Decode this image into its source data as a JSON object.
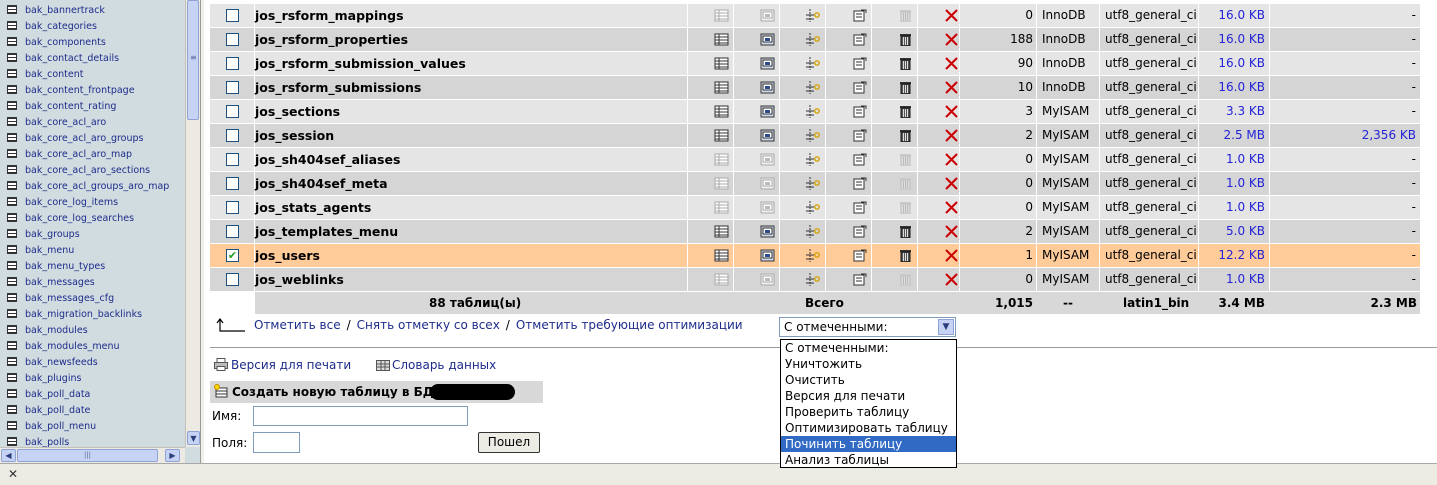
{
  "sidebar": {
    "items": [
      "bak_bannertrack",
      "bak_categories",
      "bak_components",
      "bak_contact_details",
      "bak_content",
      "bak_content_frontpage",
      "bak_content_rating",
      "bak_core_acl_aro",
      "bak_core_acl_aro_groups",
      "bak_core_acl_aro_map",
      "bak_core_acl_aro_sections",
      "bak_core_acl_groups_aro_map",
      "bak_core_log_items",
      "bak_core_log_searches",
      "bak_groups",
      "bak_menu",
      "bak_menu_types",
      "bak_messages",
      "bak_messages_cfg",
      "bak_migration_backlinks",
      "bak_modules",
      "bak_modules_menu",
      "bak_newsfeeds",
      "bak_plugins",
      "bak_poll_data",
      "bak_poll_date",
      "bak_poll_menu",
      "bak_polls"
    ]
  },
  "tables": [
    {
      "name": "jos_rsform_mappings",
      "rows": "0",
      "engine": "InnoDB",
      "collation": "utf8_general_ci",
      "size": "16.0 KB",
      "overhead": "-",
      "checked": false,
      "empty": true
    },
    {
      "name": "jos_rsform_properties",
      "rows": "188",
      "engine": "InnoDB",
      "collation": "utf8_general_ci",
      "size": "16.0 KB",
      "overhead": "-",
      "checked": false,
      "empty": false
    },
    {
      "name": "jos_rsform_submission_values",
      "rows": "90",
      "engine": "InnoDB",
      "collation": "utf8_general_ci",
      "size": "16.0 KB",
      "overhead": "-",
      "checked": false,
      "empty": false
    },
    {
      "name": "jos_rsform_submissions",
      "rows": "10",
      "engine": "InnoDB",
      "collation": "utf8_general_ci",
      "size": "16.0 KB",
      "overhead": "-",
      "checked": false,
      "empty": false
    },
    {
      "name": "jos_sections",
      "rows": "3",
      "engine": "MyISAM",
      "collation": "utf8_general_ci",
      "size": "3.3 KB",
      "overhead": "-",
      "checked": false,
      "empty": false
    },
    {
      "name": "jos_session",
      "rows": "2",
      "engine": "MyISAM",
      "collation": "utf8_general_ci",
      "size": "2.5 MB",
      "overhead": "2,356 KB",
      "checked": false,
      "empty": false
    },
    {
      "name": "jos_sh404sef_aliases",
      "rows": "0",
      "engine": "MyISAM",
      "collation": "utf8_general_ci",
      "size": "1.0 KB",
      "overhead": "-",
      "checked": false,
      "empty": true
    },
    {
      "name": "jos_sh404sef_meta",
      "rows": "0",
      "engine": "MyISAM",
      "collation": "utf8_general_ci",
      "size": "1.0 KB",
      "overhead": "-",
      "checked": false,
      "empty": true
    },
    {
      "name": "jos_stats_agents",
      "rows": "0",
      "engine": "MyISAM",
      "collation": "utf8_general_ci",
      "size": "1.0 KB",
      "overhead": "-",
      "checked": false,
      "empty": true
    },
    {
      "name": "jos_templates_menu",
      "rows": "2",
      "engine": "MyISAM",
      "collation": "utf8_general_ci",
      "size": "5.0 KB",
      "overhead": "-",
      "checked": false,
      "empty": false
    },
    {
      "name": "jos_users",
      "rows": "1",
      "engine": "MyISAM",
      "collation": "utf8_general_ci",
      "size": "12.2 KB",
      "overhead": "-",
      "checked": true,
      "empty": false
    },
    {
      "name": "jos_weblinks",
      "rows": "0",
      "engine": "MyISAM",
      "collation": "utf8_general_ci",
      "size": "1.0 KB",
      "overhead": "-",
      "checked": false,
      "empty": true
    }
  ],
  "summary": {
    "count": "88 таблиц(ы)",
    "total_label": "Всего",
    "rows": "1,015",
    "engine": "--",
    "collation": "latin1_bin",
    "size": "3.4 MB",
    "overhead": "2.3 MB"
  },
  "checkbar": {
    "check_all": "Отметить все",
    "sep": "/",
    "uncheck_all": "Снять отметку со всех",
    "check_overhead": "Отметить требующие оптимизации"
  },
  "with_selected": {
    "value": "С отмеченными:",
    "options": [
      "С отмеченными:",
      "Уничтожить",
      "Очистить",
      "Версия для печати",
      "Проверить таблицу",
      "Оптимизировать таблицу",
      "Починить таблицу",
      "Анализ таблицы"
    ],
    "highlighted_index": 6
  },
  "links": {
    "print": "Версия для печати",
    "dictionary": "Словарь данных"
  },
  "create_table": {
    "title": "Создать новую таблицу в БД",
    "name_label": "Имя:",
    "fields_label": "Поля:",
    "go_label": "Пошел"
  },
  "colors": {
    "row_light": "#e5e5e5",
    "row_dark": "#d5d5d5",
    "row_selected": "#ffcc99",
    "link": "#1e2c8a",
    "size_link": "#2323d8",
    "drop_red": "#cc0000"
  }
}
